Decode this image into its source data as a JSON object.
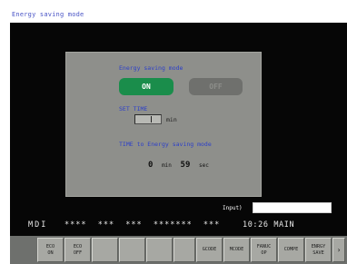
{
  "title": "Energy saving mode",
  "panel": {
    "title": "Energy saving mode",
    "on_label": "ON",
    "off_label": "OFF",
    "set_time_label": "SET TIME",
    "set_time_unit": "min",
    "remaining_label": "TIME to Energy saving mode",
    "remaining": {
      "minutes": "0",
      "min_unit": "min",
      "seconds": "59",
      "sec_unit": "sec"
    }
  },
  "input": {
    "label": "Input)",
    "value": ""
  },
  "status": {
    "mode": "MDI",
    "indicators": "****  ***  ***  *******  ***",
    "time": "10:26",
    "position": "MAIN"
  },
  "softkeys": [
    {
      "label": "ECO\nON"
    },
    {
      "label": "ECO\nOFF"
    },
    {
      "label": ""
    },
    {
      "label": ""
    },
    {
      "label": ""
    },
    {
      "label": ""
    },
    {
      "label": "GCODE"
    },
    {
      "label": "MCODE"
    },
    {
      "label": "FANUC\nOP"
    },
    {
      "label": "COMPE"
    },
    {
      "label": "ENRGY\nSAVE"
    },
    {
      "label": "›"
    }
  ],
  "colors": {
    "screen_bg": "#060606",
    "panel_bg": "#8e8f8b",
    "accent_text": "#2c3fc9",
    "on_button": "#1a8d4b",
    "off_button": "#6f706d"
  }
}
